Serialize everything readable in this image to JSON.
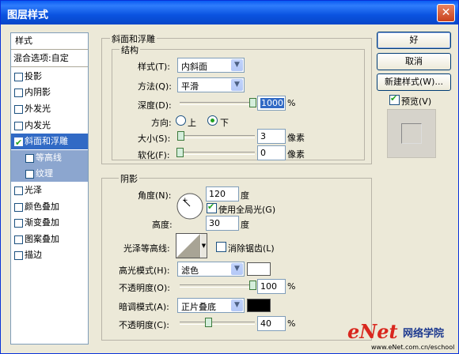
{
  "window": {
    "title": "图层样式",
    "close": "✕"
  },
  "left_panel": {
    "header": "样式",
    "blend": "混合选项:自定",
    "items": [
      {
        "label": "投影",
        "checked": false
      },
      {
        "label": "内阴影",
        "checked": false
      },
      {
        "label": "外发光",
        "checked": false
      },
      {
        "label": "内发光",
        "checked": false
      },
      {
        "label": "斜面和浮雕",
        "checked": true
      },
      {
        "label": "等高线",
        "checked": false
      },
      {
        "label": "纹理",
        "checked": false
      },
      {
        "label": "光泽",
        "checked": false
      },
      {
        "label": "颜色叠加",
        "checked": false
      },
      {
        "label": "渐变叠加",
        "checked": false
      },
      {
        "label": "图案叠加",
        "checked": false
      },
      {
        "label": "描边",
        "checked": false
      }
    ]
  },
  "bevel": {
    "group_title": "斜面和浮雕",
    "structure_title": "结构",
    "style_label": "样式(T):",
    "style_value": "内斜面",
    "method_label": "方法(Q):",
    "method_value": "平滑",
    "depth_label": "深度(D):",
    "depth_value": "1000",
    "depth_unit": "%",
    "direction_label": "方向:",
    "dir_up": "上",
    "dir_down": "下",
    "size_label": "大小(S):",
    "size_value": "3",
    "size_unit": "像素",
    "soften_label": "软化(F):",
    "soften_value": "0",
    "soften_unit": "像素"
  },
  "shading": {
    "title": "阴影",
    "angle_label": "角度(N):",
    "angle_value": "120",
    "angle_unit": "度",
    "global_light": "使用全局光(G)",
    "altitude_label": "高度:",
    "altitude_value": "30",
    "altitude_unit": "度",
    "gloss_label": "光泽等高线:",
    "antialias": "消除锯齿(L)",
    "highlight_label": "高光模式(H):",
    "highlight_value": "滤色",
    "highlight_color": "#ffffff",
    "opacity1_label": "不透明度(O):",
    "opacity1_value": "100",
    "opacity_unit": "%",
    "shadow_label": "暗调模式(A):",
    "shadow_value": "正片叠底",
    "shadow_color": "#000000",
    "opacity2_label": "不透明度(C):",
    "opacity2_value": "40"
  },
  "buttons": {
    "ok": "好",
    "cancel": "取消",
    "new_style": "新建样式(W)...",
    "preview": "预览(V)"
  },
  "watermark": {
    "brand": "eNet",
    "cn": "网络学院",
    "url": "www.eNet.com.cn/eschool"
  },
  "colors": {
    "accent": "#316ac5",
    "title_bar": "#0a53e0",
    "watermark_red": "#d9271e",
    "watermark_blue": "#1d3a8f"
  }
}
